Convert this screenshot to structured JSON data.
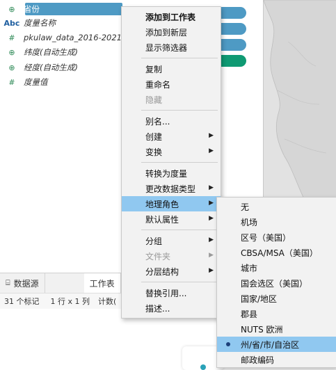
{
  "fields": [
    {
      "icon": "globe-icon",
      "glyph": "⊕",
      "label": "省份",
      "selected": true
    },
    {
      "icon": "abc-icon",
      "glyph": "Abc",
      "label": "度量名称",
      "selected": false
    },
    {
      "icon": "number-icon",
      "glyph": "#",
      "label": "pkulaw_data_2016-2021.",
      "selected": false
    },
    {
      "icon": "globe-icon",
      "glyph": "⊕",
      "label": "纬度(自动生成)",
      "selected": false
    },
    {
      "icon": "globe-icon",
      "glyph": "⊕",
      "label": "经度(自动生成)",
      "selected": false
    },
    {
      "icon": "number-icon",
      "glyph": "#",
      "label": "度量值",
      "selected": false
    }
  ],
  "pill_colors": [
    "#4e9ac4",
    "#4e9ac4",
    "#4e9ac4",
    "#0f9a73"
  ],
  "tabs": {
    "datasource": "数据源",
    "sheet": "工作表"
  },
  "status": {
    "marks": "31 个标记",
    "rows": "1 行 x 1 列",
    "sum": "计数("
  },
  "main_menu": [
    {
      "label": "添加到工作表",
      "bold": true
    },
    {
      "label": "添加到新层"
    },
    {
      "label": "显示筛选器"
    },
    {
      "sep": true
    },
    {
      "label": "复制"
    },
    {
      "label": "重命名"
    },
    {
      "label": "隐藏",
      "disabled": true
    },
    {
      "sep": true
    },
    {
      "label": "别名..."
    },
    {
      "label": "创建",
      "arrow": true
    },
    {
      "label": "变换",
      "arrow": true
    },
    {
      "sep": true
    },
    {
      "label": "转换为度量"
    },
    {
      "label": "更改数据类型",
      "arrow": true
    },
    {
      "label": "地理角色",
      "arrow": true,
      "highlight": true
    },
    {
      "label": "默认属性",
      "arrow": true
    },
    {
      "sep": true
    },
    {
      "label": "分组",
      "arrow": true
    },
    {
      "label": "文件夹",
      "arrow": true,
      "disabled": true
    },
    {
      "label": "分层结构",
      "arrow": true
    },
    {
      "sep": true
    },
    {
      "label": "替换引用..."
    },
    {
      "label": "描述..."
    }
  ],
  "geo_submenu": [
    {
      "label": "无"
    },
    {
      "label": "机场"
    },
    {
      "label": "区号（美国）"
    },
    {
      "label": "CBSA/MSA（美国）"
    },
    {
      "label": "城市"
    },
    {
      "label": "国会选区（美国）"
    },
    {
      "label": "国家/地区"
    },
    {
      "label": "郡县"
    },
    {
      "label": "NUTS 欧洲"
    },
    {
      "label": "州/省/市/自治区",
      "checked": true
    },
    {
      "label": "邮政编码"
    }
  ]
}
